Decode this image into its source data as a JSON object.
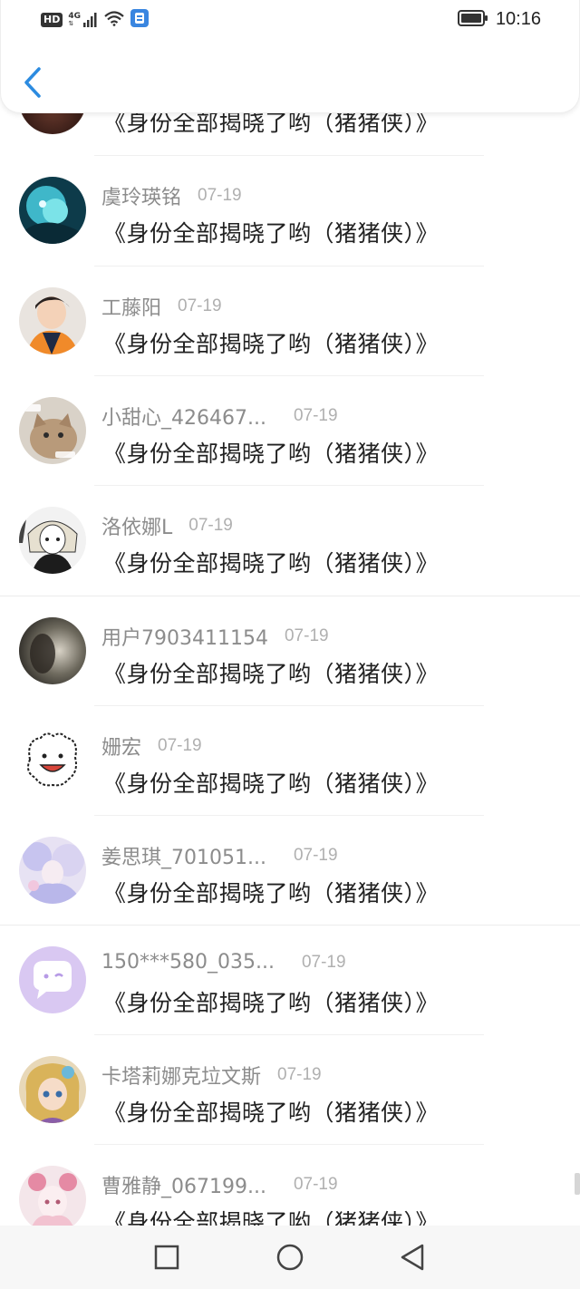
{
  "status_bar": {
    "hd": "HD",
    "network": "4G",
    "time": "10:16"
  },
  "header": {
    "back_icon": "chevron-left-icon",
    "accent_color": "#2c8be0"
  },
  "list": {
    "partial_top_title": "《身份全部揭晓了哟（猪猪侠）》",
    "items": [
      {
        "name": "虞玲瑛铭",
        "date": "07-19",
        "title": "《身份全部揭晓了哟（猪猪侠）》",
        "avatar": "avatar-teal-creature"
      },
      {
        "name": "工藤阳",
        "date": "07-19",
        "title": "《身份全部揭晓了哟（猪猪侠）》",
        "avatar": "avatar-boy-orange"
      },
      {
        "name": "小甜心_426467...",
        "date": "07-19",
        "title": "《身份全部揭晓了哟（猪猪侠）》",
        "avatar": "avatar-cat"
      },
      {
        "name": "洛依娜L",
        "date": "07-19",
        "title": "《身份全部揭晓了哟（猪猪侠）》",
        "avatar": "avatar-manga-girl"
      },
      {
        "name": "用户7903411154",
        "date": "07-19",
        "title": "《身份全部揭晓了哟（猪猪侠）》",
        "avatar": "avatar-dark-photo"
      },
      {
        "name": "姗宏",
        "date": "07-19",
        "title": "《身份全部揭晓了哟（猪猪侠）》",
        "avatar": "avatar-white-bear"
      },
      {
        "name": "姜思琪_701051...",
        "date": "07-19",
        "title": "《身份全部揭晓了哟（猪猪侠）》",
        "avatar": "avatar-lavender-girl"
      },
      {
        "name": "150***580_035...",
        "date": "07-19",
        "title": "《身份全部揭晓了哟（猪猪侠）》",
        "avatar": "avatar-chat-bubble"
      },
      {
        "name": "卡塔莉娜克垃文斯",
        "date": "07-19",
        "title": "《身份全部揭晓了哟（猪猪侠）》",
        "avatar": "avatar-doll-girl"
      },
      {
        "name": "曹雅静_067199...",
        "date": "07-19",
        "title": "《身份全部揭晓了哟（猪猪侠）》",
        "avatar": "avatar-pink-girl"
      }
    ]
  },
  "nav_bar": {
    "buttons": [
      "square-icon",
      "circle-icon",
      "triangle-back-icon"
    ]
  }
}
